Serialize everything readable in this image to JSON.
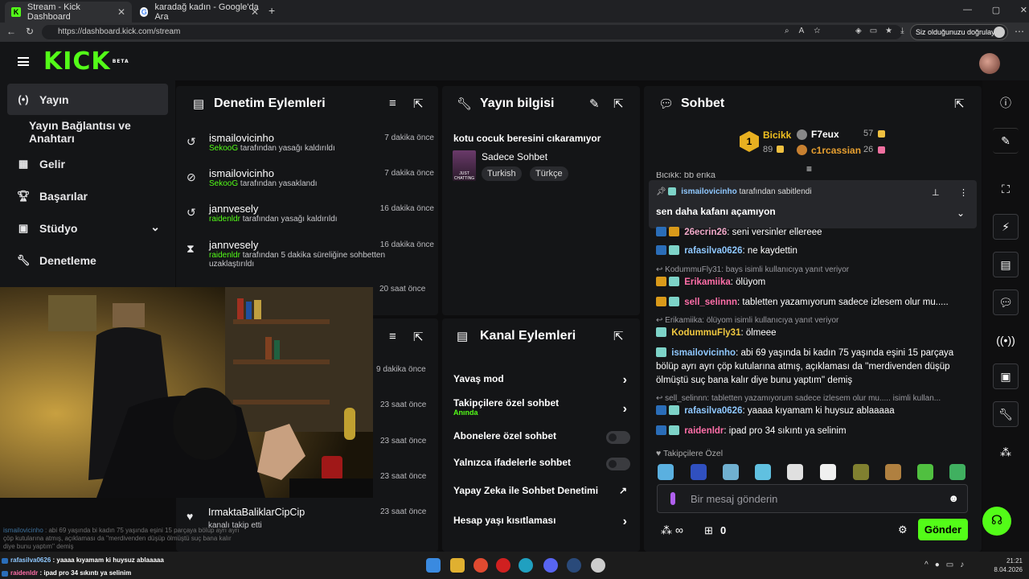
{
  "browser": {
    "tabs": [
      {
        "title": "Stream - Kick Dashboard",
        "active": true
      },
      {
        "title": "karadağ kadın - Google'da Ara",
        "active": false
      }
    ],
    "url": "https://dashboard.kick.com/stream",
    "verify_label": "Siz olduğunuzu doğrulayın"
  },
  "kick": {
    "logo": "KICK",
    "logo_tag": "BETA"
  },
  "sidebar": {
    "items": [
      {
        "label": "Yayın",
        "icon": "broadcast-icon"
      },
      {
        "label": "Yayın Bağlantısı ve Anahtarı",
        "icon": ""
      },
      {
        "label": "Gelir",
        "icon": "revenue-icon"
      },
      {
        "label": "Başarılar",
        "icon": "trophy-icon"
      },
      {
        "label": "Stüdyo",
        "icon": "studio-icon"
      },
      {
        "label": "Denetleme",
        "icon": "wrench-icon"
      }
    ]
  },
  "mod_panel": {
    "title": "Denetim Eylemleri",
    "rows": [
      {
        "name": "ismailovicinho",
        "actor": "SekooG",
        "action": " tarafından yasağı kaldırıldı",
        "time": "7 dakika önce"
      },
      {
        "name": "ismailovicinho",
        "actor": "SekooG",
        "action": " tarafından yasaklandı",
        "time": "7 dakika önce"
      },
      {
        "name": "jannvesely",
        "actor": "raidenldr",
        "action": " tarafından yasağı kaldırıldı",
        "time": "16 dakika önce"
      },
      {
        "name": "jannvesely",
        "actor": "raidenldr",
        "action": " tarafından 5 dakika süreliğine sohbetten uzaklaştırıldı",
        "time": "16 dakika önce"
      }
    ],
    "time5": "20 saat önce"
  },
  "events_panel": {
    "times": [
      "9 dakika önce",
      "23 saat önce",
      "23 saat önce",
      "23 saat önce"
    ],
    "last": {
      "name": "IrmaktaBaliklarCipCip",
      "action": "kanalı takip etti",
      "time": "23 saat önce"
    }
  },
  "stream_info": {
    "title": "Yayın bilgisi",
    "stream_title": "kotu cocuk beresini cıkaramıyor",
    "category": "Sadece Sohbet",
    "thumb_text": "JUST CHATTING",
    "tags": [
      "Turkish",
      "Türkçe"
    ]
  },
  "channel_actions": {
    "title": "Kanal Eylemleri",
    "rows": [
      {
        "label": "Yavaş mod",
        "control": "chevron"
      },
      {
        "label": "Takipçilere özel sohbet",
        "sub": "Anında",
        "control": "chevron"
      },
      {
        "label": "Abonelere özel sohbet",
        "control": "toggle"
      },
      {
        "label": "Yalnızca ifadelerle sohbet",
        "control": "toggle"
      },
      {
        "label": "Yapay Zeka ile Sohbet Denetimi",
        "control": "external"
      },
      {
        "label": "Hesap yaşı kısıtlaması",
        "control": "chevron"
      }
    ]
  },
  "chat": {
    "title": "Sohbet",
    "leaders": [
      {
        "rank": "1",
        "name": "Bicikk",
        "value": "89"
      },
      {
        "name": "F7eux",
        "value": "57"
      },
      {
        "name": "c1rcassian",
        "value": "26"
      }
    ],
    "pinned": {
      "by": "ismailovicinho",
      "by_suffix": " tarafından sabitlendi",
      "text": "sen daha kafanı açamıyon"
    },
    "partial_top": "Bicikk: bb erika",
    "messages": [
      {
        "user": "26ecrin26",
        "color": "#f0a8c8",
        "text": ": seni versinler ellereee"
      },
      {
        "user": "rafasilva0626",
        "color": "#8fc8ff",
        "text": ": ne kaydettin"
      },
      {
        "reply": "KodummuFly31: bays isimli kullanıcıya yanıt veriyor"
      },
      {
        "user": "Erikamiika",
        "color": "#ff6ea8",
        "text": ": ölüyom"
      },
      {
        "user": "sell_selinnn",
        "color": "#ff6ea8",
        "text": ": tabletten yazamıyorum sadece izlesem olur mu....."
      },
      {
        "reply": "Erikamiika: ölüyom isimli kullanıcıya yanıt veriyor"
      },
      {
        "user": "KodummuFly31",
        "color": "#f0c840",
        "text": ": ölmeee"
      },
      {
        "user": "ismailovicinho",
        "color": "#8fc8ff",
        "text": ": abi 69 yaşında bi kadın 75 yaşında eşini 15 parçaya bölüp ayrı ayrı çöp kutularına atmış, açıklaması da ''merdivenden düşüp ölmüştü suç bana kalır diye bunu yaptım'' demiş"
      },
      {
        "reply": "sell_selinnn: tabletten yazamıyorum sadece izlesem olur mu..... isimli kullan..."
      },
      {
        "user": "rafasilva0626",
        "color": "#8fc8ff",
        "text": ": yaaaa kıyamam ki huysuz ablaaaaa"
      },
      {
        "user": "raidenldr",
        "color": "#ff6ea8",
        "text": ": ipad pro 34 sıkıntı ya selinim"
      }
    ],
    "followers_only": "Takipçilere Özel",
    "placeholder": "Bir mesaj gönderin",
    "points": "∞",
    "gifts": "0",
    "send": "Gönder"
  },
  "overlay": {
    "lines": [
      {
        "user": "ismailovicinho",
        "text": " : abi 69 yaşında bi kadın 75 yaşında eşini 15 parçaya bölüp ayrı ayrı çöp kutularına atmış, açıklaması da ''merdivenden düşüp ölmüştü suç bana kalır diye bunu yaptım'' demiş"
      },
      {
        "user": "rafasilva0626",
        "text": " : yaaaa kıyamam ki huysuz ablaaaaa"
      },
      {
        "user": "raidenldr",
        "text": " : ipad pro 34 sıkıntı ya selinim"
      }
    ]
  },
  "taskbar": {
    "time": "21:21",
    "date": "8.04.2026"
  },
  "colors": {
    "accent": "#53fc18",
    "panel": "#141517",
    "bg": "#0d0d0e"
  }
}
